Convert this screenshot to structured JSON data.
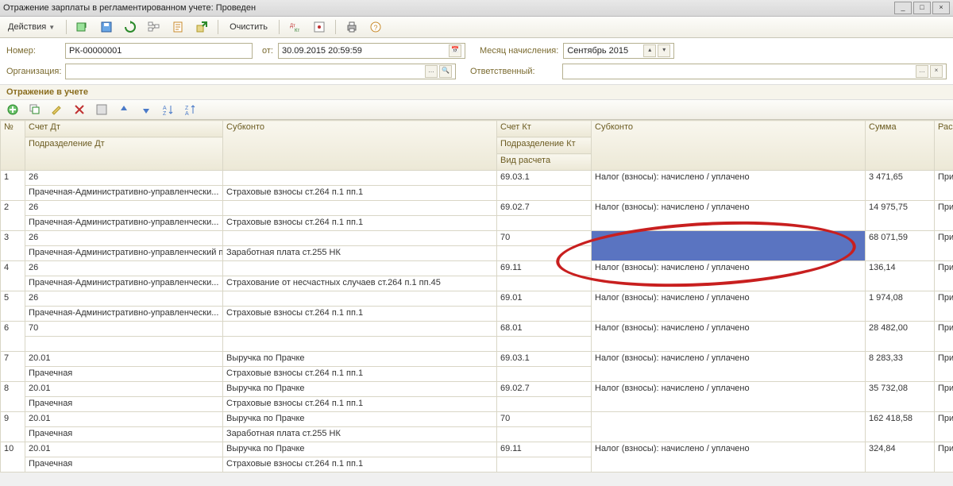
{
  "window": {
    "title": "Отражение зарплаты в регламентированном учете: Проведен"
  },
  "toolbar": {
    "actions": "Действия",
    "clear": "Очистить"
  },
  "fields": {
    "number_label": "Номер:",
    "number_value": "РК-00000001",
    "from_label": "от:",
    "from_value": "30.09.2015 20:59:59",
    "month_label": "Месяц начисления:",
    "month_value": "Сентябрь 2015",
    "org_label": "Организация:",
    "org_value": "",
    "resp_label": "Ответственный:",
    "resp_value": ""
  },
  "section": {
    "title": "Отражение в учете"
  },
  "columns": {
    "n": "№",
    "dt": "Счет Дт",
    "dt_sub": "Подразделение Дт",
    "sub1": "Субконто",
    "kt": "Счет Кт",
    "kt_sub": "Подразделение Кт",
    "vid": "Вид расчета",
    "sub2": "Субконто",
    "sum": "Сумма",
    "exp": "Расходы УС"
  },
  "rows": [
    {
      "n": "1",
      "dt": "26",
      "dt_sub": "Прачечная-Административно-управленчески...",
      "sub1": "Страховые взносы ст.264 п.1 пп.1",
      "kt": "69.03.1",
      "sub2": "Налог (взносы): начислено / уплачено",
      "sum": "3 471,65",
      "exp": "Принимают"
    },
    {
      "n": "2",
      "dt": "26",
      "dt_sub": "Прачечная-Административно-управленчески...",
      "sub1": "Страховые взносы ст.264 п.1 пп.1",
      "kt": "69.02.7",
      "sub2": "Налог (взносы): начислено / уплачено",
      "sum": "14 975,75",
      "exp": "Принимают"
    },
    {
      "n": "3",
      "dt": "26",
      "dt_sub": "Прачечная-Административно-управленческий персонал (АУП)",
      "sub1": "Заработная плата ст.255 НК",
      "kt": "70",
      "sub2": "",
      "sum": "68 071,59",
      "exp": "Принимают",
      "selected": true
    },
    {
      "n": "4",
      "dt": "26",
      "dt_sub": "Прачечная-Административно-управленчески...",
      "sub1": "Страхование от несчастных случаев ст.264 п.1 пп.45",
      "kt": "69.11",
      "sub2": "Налог (взносы): начислено / уплачено",
      "sum": "136,14",
      "exp": "Принимают"
    },
    {
      "n": "5",
      "dt": "26",
      "dt_sub": "Прачечная-Административно-управленчески...",
      "sub1": "Страховые взносы ст.264 п.1 пп.1",
      "kt": "69.01",
      "sub2": "Налог (взносы): начислено / уплачено",
      "sum": "1 974,08",
      "exp": "Принимают"
    },
    {
      "n": "6",
      "dt": "70",
      "dt_sub": "",
      "sub1": "",
      "kt": "68.01",
      "sub2": "Налог (взносы): начислено / уплачено",
      "sum": "28 482,00",
      "exp": "Принимают"
    },
    {
      "n": "7",
      "dt": "20.01",
      "dt_sub": "Прачечная",
      "sub1a": "Выручка по Прачке",
      "sub1": "Страховые взносы ст.264 п.1 пп.1",
      "kt": "69.03.1",
      "sub2": "Налог (взносы): начислено / уплачено",
      "sum": "8 283,33",
      "exp": "Принимают"
    },
    {
      "n": "8",
      "dt": "20.01",
      "dt_sub": "Прачечная",
      "sub1a": "Выручка по Прачке",
      "sub1": "Страховые взносы ст.264 п.1 пп.1",
      "kt": "69.02.7",
      "sub2": "Налог (взносы): начислено / уплачено",
      "sum": "35 732,08",
      "exp": "Принимают"
    },
    {
      "n": "9",
      "dt": "20.01",
      "dt_sub": "Прачечная",
      "sub1a": "Выручка по Прачке",
      "sub1": "Заработная плата ст.255 НК",
      "kt": "70",
      "sub2": "",
      "sum": "162 418,58",
      "exp": "Принимают"
    },
    {
      "n": "10",
      "dt": "20.01",
      "dt_sub": "Прачечная",
      "sub1a": "Выручка по Прачке",
      "sub1": "Страховые взносы ст.264 п.1 пп.1",
      "kt": "69.11",
      "sub2": "Налог (взносы): начислено / уплачено",
      "sum": "324,84",
      "exp": "Принимают"
    }
  ]
}
